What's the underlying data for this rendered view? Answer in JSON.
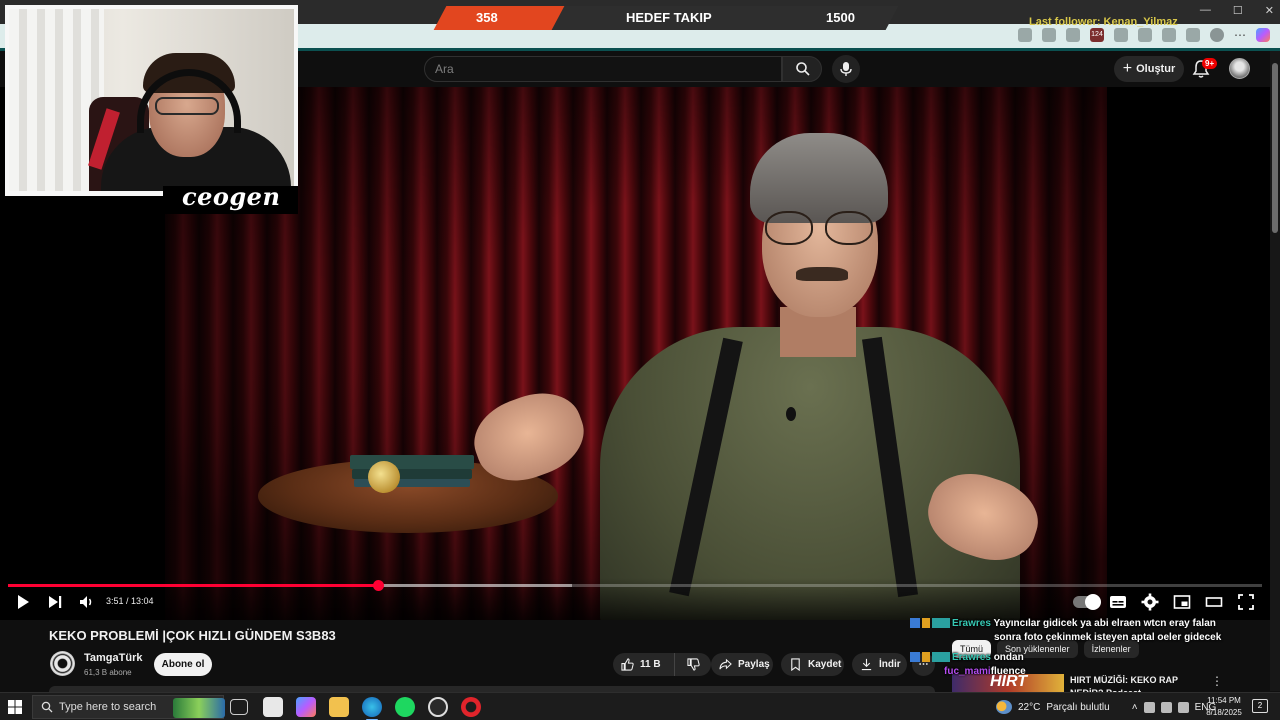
{
  "stream_overlay": {
    "follow_goal": {
      "current": "358",
      "label": "HEDEF TAKIP",
      "target": "1500"
    },
    "last_follower": "Last follower: Kenan_Yilmaz",
    "webcam_name": "ceogen"
  },
  "browser": {
    "tab_badge_count": "124"
  },
  "youtube": {
    "search": {
      "placeholder": "Ara"
    },
    "create_label": "Oluştur",
    "notification_badge": "9+"
  },
  "player": {
    "current_time": "3:51",
    "duration": "13:04",
    "time_display": "3:51 / 13:04",
    "progress_fraction": 0.295,
    "buffer_fraction": 0.45
  },
  "video": {
    "title": "KEKO PROBLEMİ |ÇOK HIZLI GÜNDEM S3B83",
    "channel": "TamgaTürk",
    "subscribers": "61,3 B abone",
    "subscribe_label": "Abone ol",
    "likes": "11 B",
    "share_label": "Paylaş",
    "save_label": "Kaydet",
    "download_label": "İndir"
  },
  "chips": [
    {
      "label": "Tümü",
      "active": true
    },
    {
      "label": "Son yüklenenler",
      "active": false
    },
    {
      "label": "İzlenenler",
      "active": false
    }
  ],
  "recommendation": {
    "thumb_text": "HIRT",
    "title": "HIRT MÜZİĞİ: KEKO RAP NEDİR? Podcast"
  },
  "chat": [
    {
      "user": "Erawres",
      "message": "Yayıncılar gidicek ya abi elraen wtcn eray falan",
      "continuation": "sonra foto çekinmek isteyen aptal oeler gidecek"
    },
    {
      "user": "Erawres",
      "message": "ondan"
    },
    {
      "user": "fuc_mami",
      "message": "fluence"
    }
  ],
  "taskbar": {
    "search_placeholder": "Type here to search",
    "weather_temp": "22°C",
    "weather_desc": "Parçalı bulutlu",
    "language": "ENG",
    "time": "11:54 PM",
    "date": "8/18/2025",
    "notification_count": "2"
  },
  "colors": {
    "accent_red": "#ff0033",
    "goal_orange": "#e2461f",
    "chat_name": "#36c8b4"
  }
}
